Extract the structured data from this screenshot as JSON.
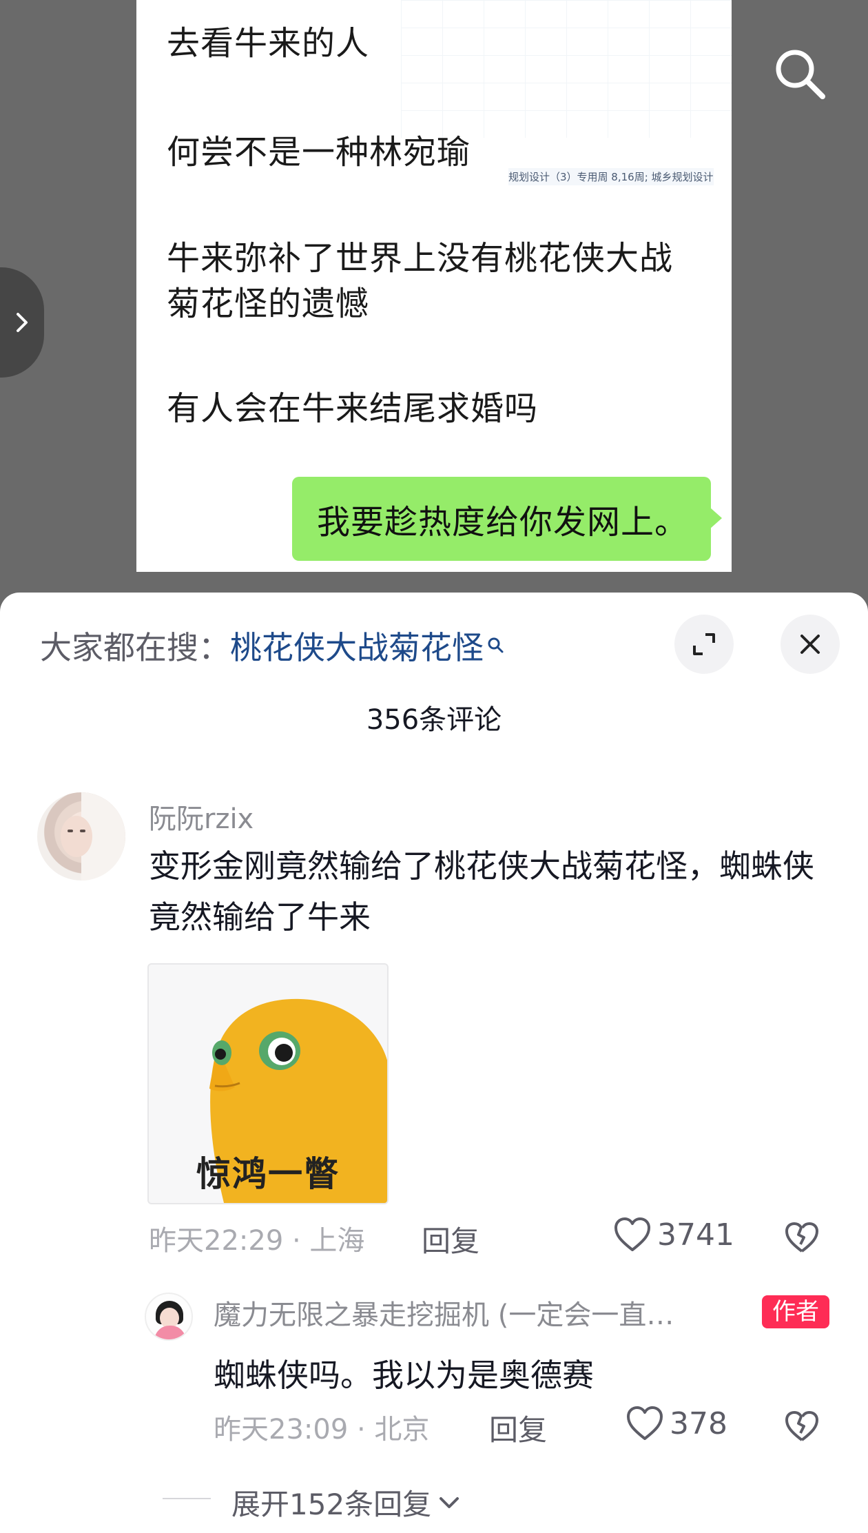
{
  "video": {
    "messages": [
      "去看牛来的人",
      "何尝不是一种林宛瑜",
      "牛来弥补了世界上没有桃花侠大战",
      "菊花怪的遗憾",
      "有人会在牛来结尾求婚吗"
    ],
    "bubble_text": "我要趁热度给你发网上。",
    "background_strip": "规划设计（3）专用周 8,16周; 城乡规划设计"
  },
  "comments_panel": {
    "hot_search_label": "大家都在搜：",
    "hot_search_term": "桃花侠大战菊花怪",
    "comment_count": "356条评论",
    "expand_icon": "expand-icon",
    "close_icon": "close-icon"
  },
  "comment": {
    "username": "阮阮rzix",
    "text": "变形金刚竟然输给了桃花侠大战菊花怪，蜘蛛侠竟然输给了牛来",
    "sticker_caption": "惊鸿一瞥",
    "time_location": "昨天22:29 · 上海",
    "reply_label": "回复",
    "likes": "3741"
  },
  "reply": {
    "username": "魔力无限之暴走挖掘机 (一定会一直…",
    "author_badge": "作者",
    "text": "蜘蛛侠吗。我以为是奥德赛",
    "time_location": "昨天23:09 · 北京",
    "reply_label": "回复",
    "likes": "378"
  },
  "expand_replies": "展开152条回复",
  "colors": {
    "author_badge": "#fe2c55",
    "hot_search_term": "#1e4a8a",
    "bubble": "#95ec69"
  }
}
